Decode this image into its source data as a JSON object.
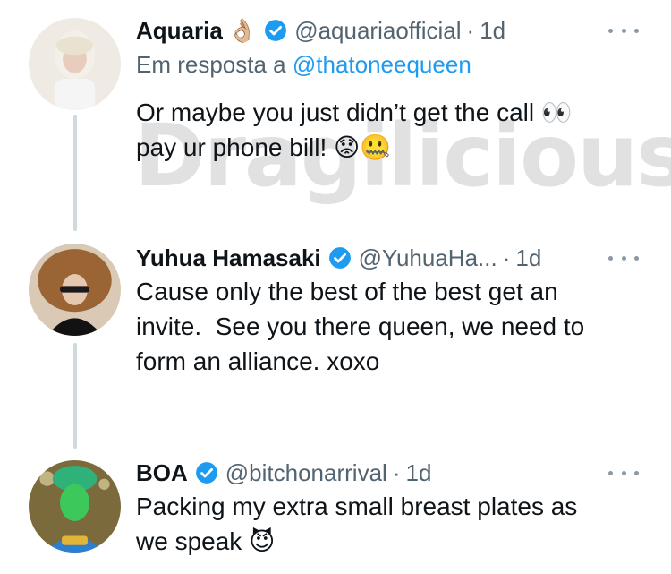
{
  "watermark": "Dragilicious",
  "tweets": [
    {
      "name": "Aquaria",
      "name_emoji": "👌🏼",
      "handle": "@aquariaofficial",
      "dot": "·",
      "time": "1d",
      "reply_prefix": "Em resposta a",
      "reply_to": "@thatoneequeen",
      "text": "Or maybe you just didn’t get the call 👀\npay ur phone bill! 😟🤐"
    },
    {
      "name": "Yuhua Hamasaki",
      "handle": "@YuhuaHa...",
      "dot": "·",
      "time": "1d",
      "text": "Cause only the best of the best get an\ninvite.  See you there queen, we need to\nform an alliance. xoxo"
    },
    {
      "name": "BOA",
      "handle": "@bitchonarrival",
      "dot": "·",
      "time": "1d",
      "text": "Packing my extra small breast plates as\nwe speak 😈"
    }
  ],
  "colors": {
    "name": "#0f1419",
    "secondary": "#536471",
    "link": "#1d9bf0",
    "verified": "#1d9bf0",
    "thread_line": "#cfd9de"
  },
  "icons": [
    "verified-badge-icon",
    "more-options-icon"
  ]
}
